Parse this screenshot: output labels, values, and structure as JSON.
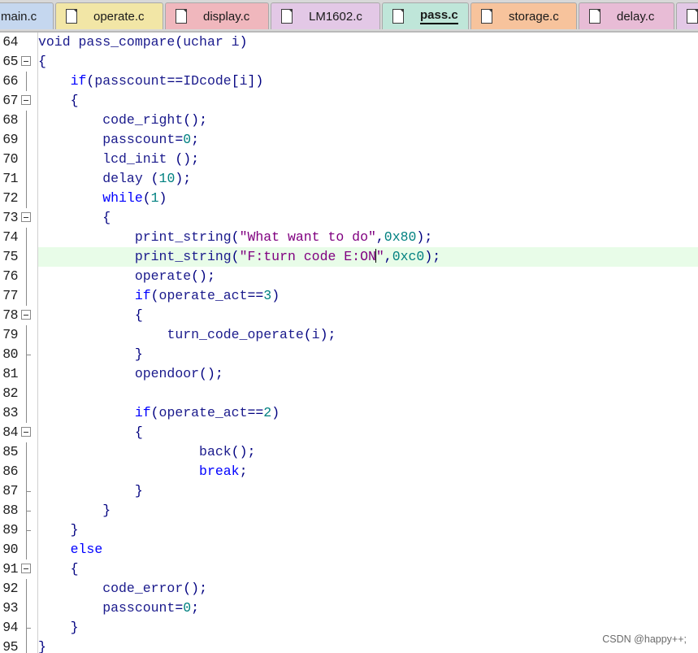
{
  "tabs": [
    {
      "label": "main.c",
      "color": "#c5d7ef",
      "active": false
    },
    {
      "label": "operate.c",
      "color": "#f2e6a6",
      "active": false
    },
    {
      "label": "display.c",
      "color": "#f0b7bd",
      "active": false
    },
    {
      "label": "LM1602.c",
      "color": "#e3c8e6",
      "active": false
    },
    {
      "label": "pass.c",
      "color": "#bfe6d9",
      "active": true
    },
    {
      "label": "storage.c",
      "color": "#f7c39c",
      "active": false
    },
    {
      "label": "delay.c",
      "color": "#e8bcd6",
      "active": false
    }
  ],
  "editor": {
    "current_line": 75,
    "lines": [
      {
        "n": "64",
        "text": "void pass_compare(uchar i)"
      },
      {
        "n": "65",
        "text": "{"
      },
      {
        "n": "66",
        "text": "    if(passcount==IDcode[i])"
      },
      {
        "n": "67",
        "text": "    {"
      },
      {
        "n": "68",
        "text": "        code_right();"
      },
      {
        "n": "69",
        "text": "        passcount=0;"
      },
      {
        "n": "70",
        "text": "        lcd_init ();"
      },
      {
        "n": "71",
        "text": "        delay (10);"
      },
      {
        "n": "72",
        "text": "        while(1)"
      },
      {
        "n": "73",
        "text": "        {"
      },
      {
        "n": "74",
        "text": "            print_string(\"What want to do\",0x80);"
      },
      {
        "n": "75",
        "text": "            print_string(\"F:turn code E:ON\",0xc0);"
      },
      {
        "n": "76",
        "text": "            operate();"
      },
      {
        "n": "77",
        "text": "            if(operate_act==3)"
      },
      {
        "n": "78",
        "text": "            {"
      },
      {
        "n": "79",
        "text": "                turn_code_operate(i);"
      },
      {
        "n": "80",
        "text": "            }"
      },
      {
        "n": "81",
        "text": "            opendoor();"
      },
      {
        "n": "82",
        "text": ""
      },
      {
        "n": "83",
        "text": "            if(operate_act==2)"
      },
      {
        "n": "84",
        "text": "            {"
      },
      {
        "n": "85",
        "text": "                    back();"
      },
      {
        "n": "86",
        "text": "                    break;"
      },
      {
        "n": "87",
        "text": "            }"
      },
      {
        "n": "88",
        "text": "        }"
      },
      {
        "n": "89",
        "text": "    }"
      },
      {
        "n": "90",
        "text": "    else"
      },
      {
        "n": "91",
        "text": "    {"
      },
      {
        "n": "92",
        "text": "        code_error();"
      },
      {
        "n": "93",
        "text": "        passcount=0;"
      },
      {
        "n": "94",
        "text": "    }"
      },
      {
        "n": "95",
        "text": "}"
      }
    ]
  },
  "watermark": "CSDN @happy++;"
}
